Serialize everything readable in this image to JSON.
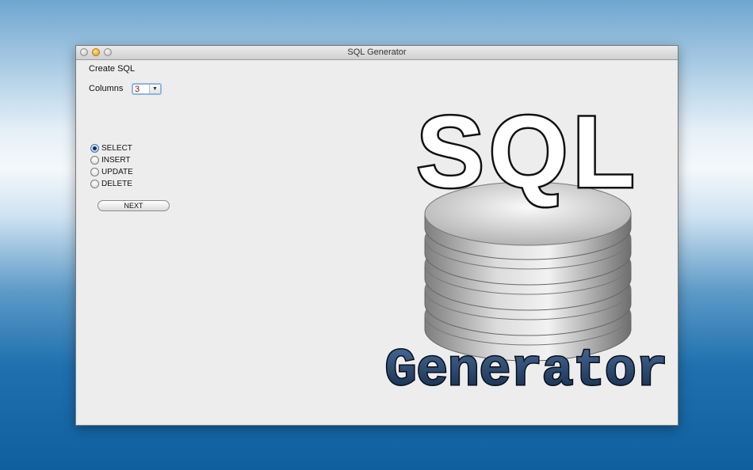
{
  "window": {
    "title": "SQL Generator"
  },
  "form": {
    "heading": "Create SQL",
    "columns_label": "Columns",
    "columns_value": "3",
    "options": [
      "SELECT",
      "INSERT",
      "UPDATE",
      "DELETE"
    ],
    "selected_option": "SELECT",
    "next_label": "NEXT"
  },
  "logo": {
    "top_text": "SQL",
    "bottom_text": "Generator"
  },
  "colors": {
    "logo_text_top": "#ffffff",
    "logo_text_bottom": "#1f3a63",
    "radio_selected": "#9cc4ef",
    "combo_focus": "#8fb4e4"
  }
}
